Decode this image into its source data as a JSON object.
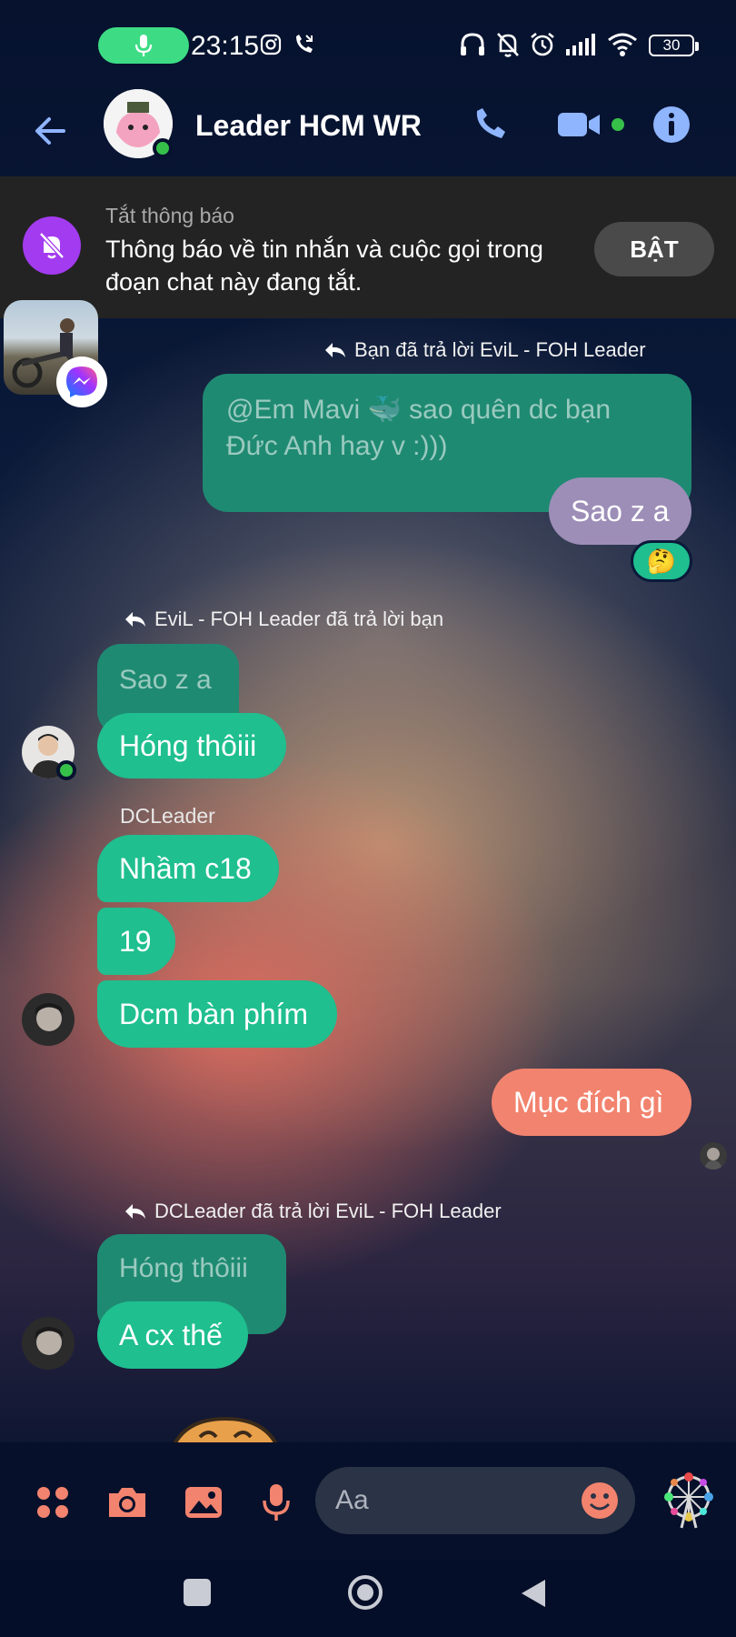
{
  "status_bar": {
    "time": "23:15",
    "battery": "30"
  },
  "header": {
    "title": "Leader HCM WR"
  },
  "mute_banner": {
    "title": "Tắt thông báo",
    "text": "Thông báo về tin nhắn và cuộc gọi trong đoạn chat này đang tắt.",
    "button_label": "BẬT"
  },
  "messages": {
    "m1": {
      "reply_note": "Bạn đã trả lời EviL - FOH Leader",
      "quoted": "@Em Mavi 🐳  sao quên dc bạn Đức Anh hay v :)))",
      "text": "Sao z a",
      "reaction": "🤔"
    },
    "m2": {
      "reply_note": "EviL - FOH Leader đã trả lời bạn",
      "quoted": "Sao z a",
      "text": "Hóng thôiii"
    },
    "m3": {
      "sender": "DCLeader",
      "texts": [
        "Nhầm c18",
        "19",
        "Dcm bàn phím"
      ]
    },
    "m4": {
      "text": "Mục đích gì"
    },
    "m5": {
      "reply_note": "DCLeader đã trả lời EviL - FOH Leader",
      "quoted": "Hóng thôiii",
      "text": "A cx thế"
    }
  },
  "composer": {
    "placeholder": "Aa"
  },
  "colors": {
    "outgoing_bubble": "#1f8a72",
    "incoming_bubble": "#1fbf8f",
    "accent_icons": "#f2836e",
    "header_icons": "#8fb5ff",
    "mute_purple": "#a33bf0"
  },
  "icons": [
    "mic-icon",
    "instagram-icon",
    "missed-call-icon",
    "headphones-icon",
    "bell-off-icon",
    "alarm-icon",
    "signal-icon",
    "wifi-icon",
    "back-arrow-icon",
    "phone-icon",
    "video-camera-icon",
    "info-icon",
    "messenger-icon",
    "reply-icon",
    "apps-grid-icon",
    "camera-icon",
    "image-icon",
    "microphone-icon",
    "emoji-icon",
    "ferris-wheel-icon",
    "nav-square-icon",
    "nav-home-icon",
    "nav-back-icon"
  ]
}
